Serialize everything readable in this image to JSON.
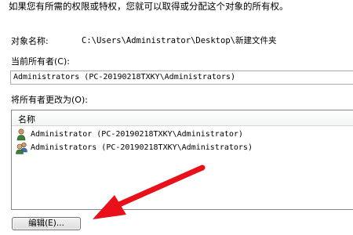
{
  "intro_text": "如果您有所需的权限或特权，您就可以取得或分配这个对象的所有权。",
  "object_name": {
    "label": "对象名称:",
    "value": "C:\\Users\\Administrator\\Desktop\\新建文件夹"
  },
  "current_owner": {
    "label": "当前所有者(C):",
    "value": "Administrators (PC-20190218TXKY\\Administrators)"
  },
  "change_owner": {
    "label": "将所有者更改为(O):",
    "column_header": "名称",
    "items": [
      {
        "text": "Administrator (PC-20190218TXKY\\Administrator)",
        "icon": "user-icon"
      },
      {
        "text": "Administrators (PC-20190218TXKY\\Administrators)",
        "icon": "group-icon"
      }
    ]
  },
  "edit_button_label": "编辑(E)...",
  "annotation": {
    "arrow_color": "#e8101a"
  }
}
